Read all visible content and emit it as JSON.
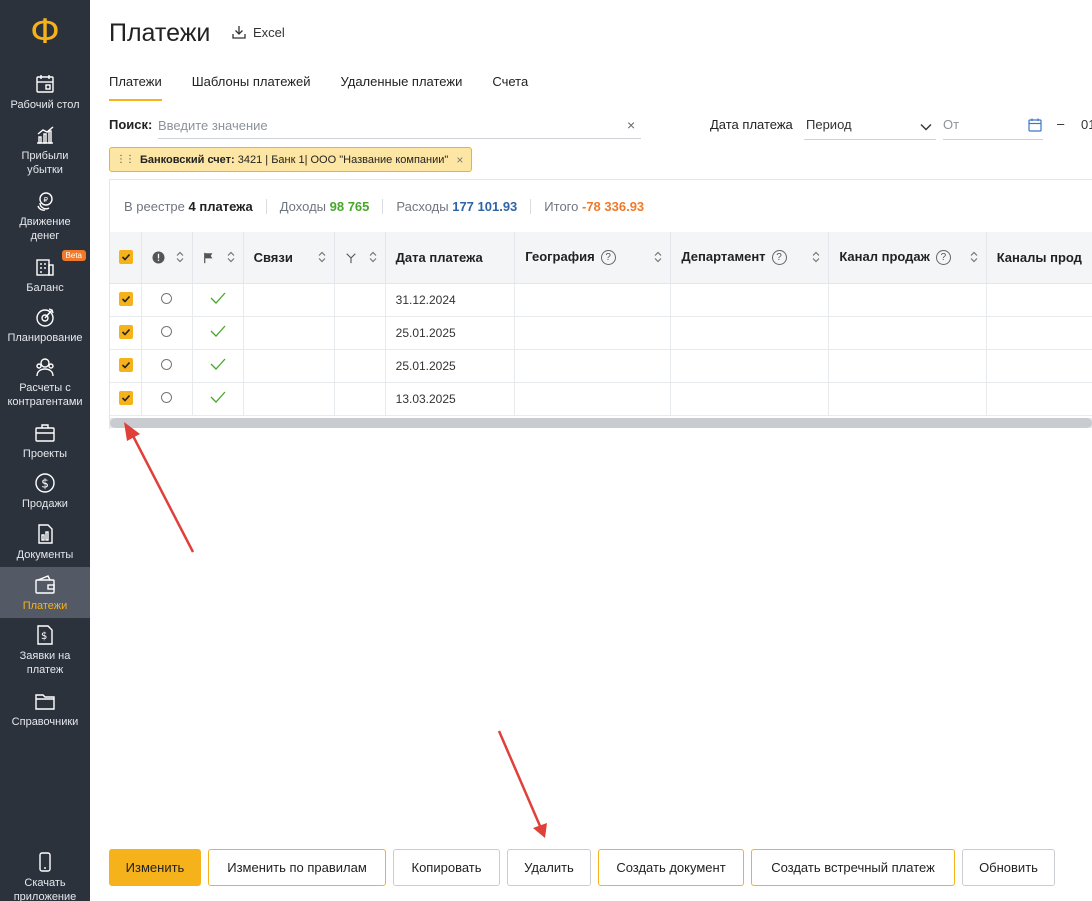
{
  "logo": "Ф",
  "sidebar": {
    "items": [
      {
        "label": "Рабочий стол",
        "icon": "calendar-icon"
      },
      {
        "label": "Прибыли убытки",
        "icon": "chart-icon"
      },
      {
        "label": "Движение денег",
        "icon": "coins-icon"
      },
      {
        "label": "Баланс",
        "icon": "building-icon",
        "badge": "Beta"
      },
      {
        "label": "Планирование",
        "icon": "target-icon"
      },
      {
        "label": "Расчеты с контрагентами",
        "icon": "people-icon"
      },
      {
        "label": "Проекты",
        "icon": "briefcase-icon"
      },
      {
        "label": "Продажи",
        "icon": "dollar-icon"
      },
      {
        "label": "Документы",
        "icon": "document-icon"
      },
      {
        "label": "Платежи",
        "icon": "wallet-icon",
        "active": true
      },
      {
        "label": "Заявки на платеж",
        "icon": "invoice-icon"
      },
      {
        "label": "Справочники",
        "icon": "folder-icon"
      }
    ],
    "bottom": {
      "label": "Скачать приложение",
      "icon": "phone-icon"
    }
  },
  "header": {
    "title": "Платежи",
    "excel_label": "Excel"
  },
  "tabs": [
    "Платежи",
    "Шаблоны платежей",
    "Удаленные платежи",
    "Счета"
  ],
  "search": {
    "label": "Поиск:",
    "placeholder": "Введите значение",
    "clear": "×"
  },
  "date_filter": {
    "label": "Дата платежа",
    "period_value": "Период",
    "from_placeholder": "От",
    "dash": "–",
    "to_stub": "01"
  },
  "filter_chip": {
    "key": "Банковский счет:",
    "value": "3421 | Банк 1| ООО \"Название компании\"",
    "close": "×"
  },
  "summary": {
    "registry_label": "В реестре",
    "registry_value": "4 платежа",
    "income_label": "Доходы",
    "income_value": "98 765",
    "expense_label": "Расходы",
    "expense_value": "177 101.93",
    "total_label": "Итого",
    "total_value": "-78 336.93"
  },
  "table": {
    "columns": [
      "Связи",
      "Дата платежа",
      "География",
      "Департамент",
      "Канал продаж",
      "Каналы прод"
    ],
    "help": "?",
    "rows": [
      {
        "date": "31.12.2024"
      },
      {
        "date": "25.01.2025"
      },
      {
        "date": "25.01.2025"
      },
      {
        "date": "13.03.2025"
      }
    ]
  },
  "buttons": {
    "edit": "Изменить",
    "edit_rules": "Изменить по правилам",
    "copy": "Копировать",
    "delete": "Удалить",
    "create_doc": "Создать документ",
    "create_counter": "Создать встречный платеж",
    "refresh": "Обновить"
  },
  "colors": {
    "accent": "#f6b21a",
    "sidebar": "#2c323c",
    "income": "#47a72b",
    "expense": "#2f63a7",
    "total": "#f07a2a",
    "arrow": "#e0403a"
  }
}
